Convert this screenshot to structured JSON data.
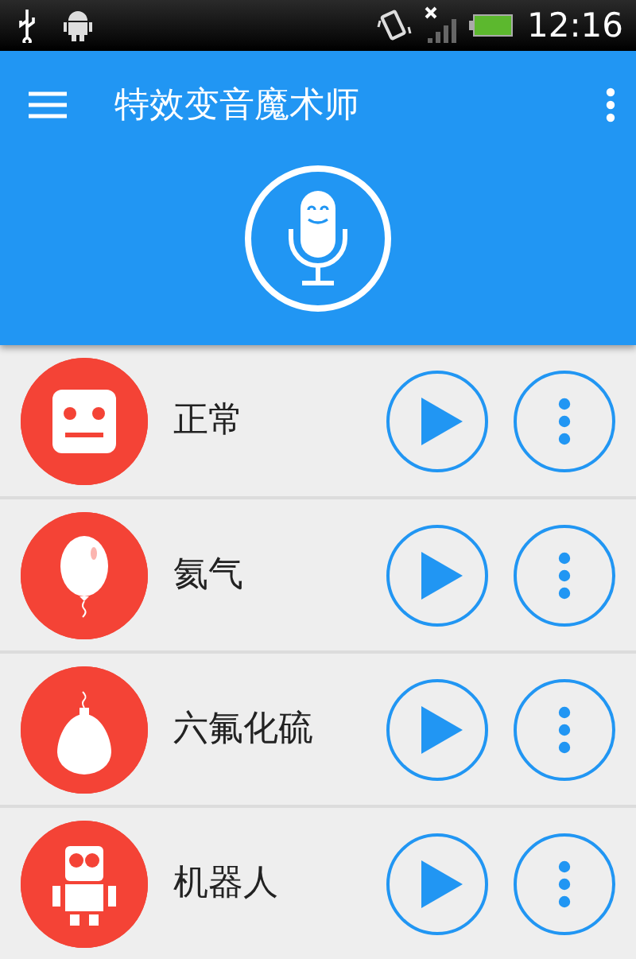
{
  "status_bar": {
    "time": "12:16"
  },
  "toolbar": {
    "title": "特效变音魔术师"
  },
  "effects": [
    {
      "kind": "normal",
      "name": "正常"
    },
    {
      "kind": "balloon",
      "name": "氦气"
    },
    {
      "kind": "heavy-balloon",
      "name": "六氟化硫"
    },
    {
      "kind": "robot",
      "name": "机器人"
    }
  ]
}
